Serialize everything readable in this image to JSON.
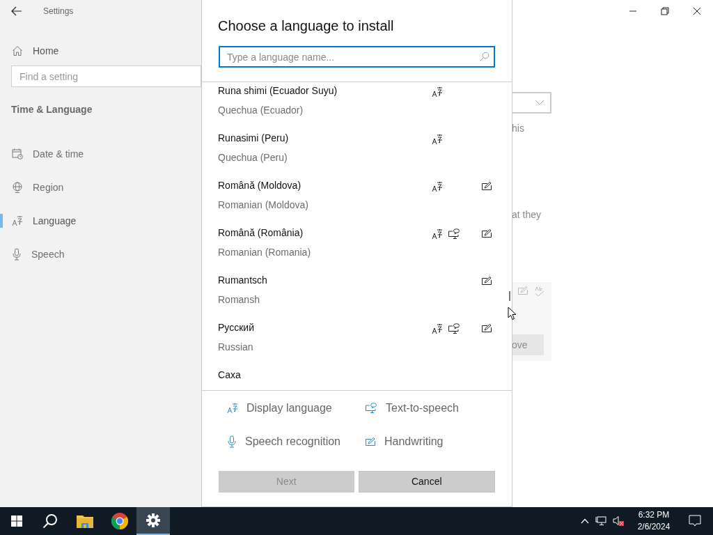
{
  "title_bar": {
    "title": "Settings"
  },
  "sidebar": {
    "home": "Home",
    "search": {
      "placeholder": "Find a setting"
    },
    "section": "Time & Language",
    "items": [
      {
        "label": "Date & time",
        "kind": "calendar",
        "selected": false
      },
      {
        "label": "Region",
        "kind": "globe",
        "selected": false
      },
      {
        "label": "Language",
        "kind": "language",
        "selected": true
      },
      {
        "label": "Speech",
        "kind": "microphone",
        "selected": false
      }
    ]
  },
  "background_fragments": {
    "line_1": "his",
    "line_2": "at they",
    "button": "ove"
  },
  "dialog": {
    "title": "Choose a language to install",
    "search": {
      "placeholder": "Type a language name..."
    },
    "languages": [
      {
        "name": "Runa shimi (Ecuador Suyu)",
        "english": "Quechua (Ecuador)",
        "display": true,
        "tts": false,
        "handwriting": false
      },
      {
        "name": "Runasimi (Peru)",
        "english": "Quechua (Peru)",
        "display": true,
        "tts": false,
        "handwriting": false
      },
      {
        "name": "Română (Moldova)",
        "english": "Romanian (Moldova)",
        "display": true,
        "tts": false,
        "handwriting": true
      },
      {
        "name": "Română (România)",
        "english": "Romanian (Romania)",
        "display": true,
        "tts": true,
        "handwriting": true
      },
      {
        "name": "Rumantsch",
        "english": "Romansh",
        "display": false,
        "tts": false,
        "handwriting": true
      },
      {
        "name": "Русский",
        "english": "Russian",
        "display": true,
        "tts": true,
        "handwriting": true
      },
      {
        "name": "Саха",
        "display": false,
        "tts": false,
        "handwriting": false
      }
    ],
    "legend": [
      {
        "label": "Display language",
        "kind": "display"
      },
      {
        "label": "Text-to-speech",
        "kind": "tts"
      },
      {
        "label": "Speech recognition",
        "kind": "speech"
      },
      {
        "label": "Handwriting",
        "kind": "handwriting"
      }
    ],
    "buttons": [
      {
        "label": "Next",
        "disabled": true
      },
      {
        "label": "Cancel",
        "disabled": false
      }
    ]
  },
  "taskbar": {
    "time": "6:32 PM",
    "date": "2/6/2024"
  }
}
